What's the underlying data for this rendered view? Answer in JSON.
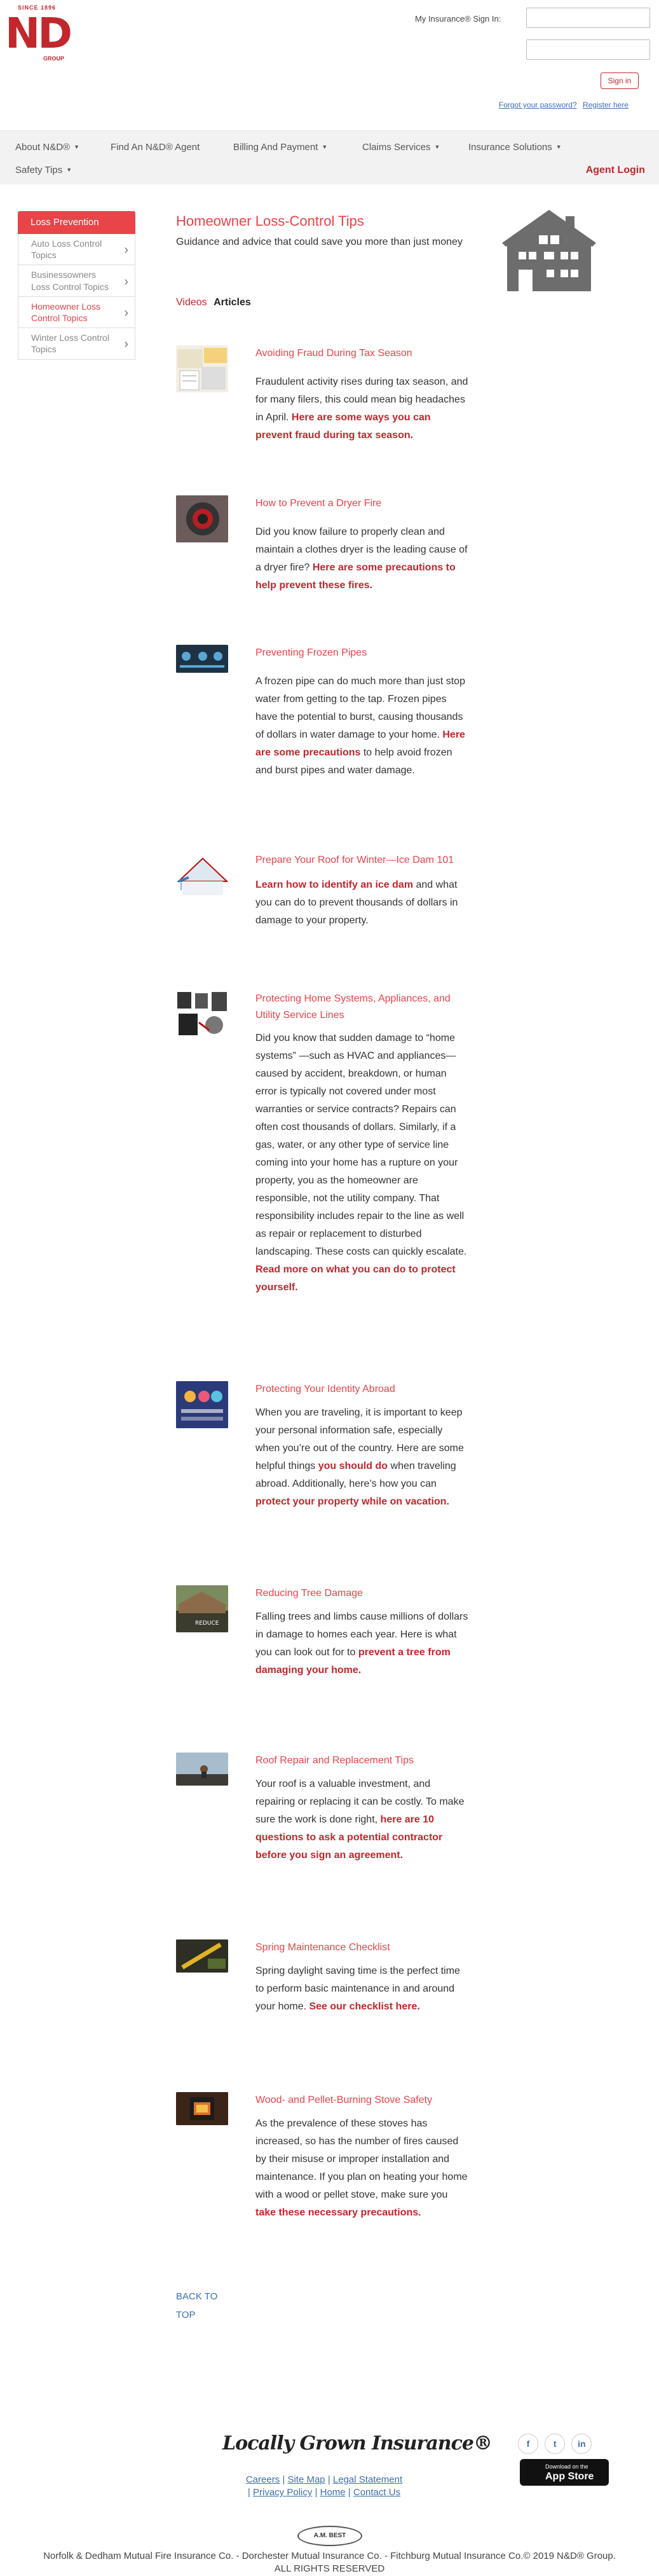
{
  "logo": {
    "tag": "SINCE 1896",
    "mark": "ND",
    "group": "GROUP"
  },
  "signin": {
    "label": "My Insurance® Sign In:",
    "button": "Sign in",
    "forgot": "Forgot your password?",
    "register": "Register here"
  },
  "nav": {
    "items": [
      "About N&D®",
      "Find An N&D® Agent",
      "Billing And Payment",
      "Claims Services",
      "Insurance Solutions",
      "Safety Tips"
    ],
    "agent_login": "Agent Login"
  },
  "sidebar": {
    "heading": "Loss Prevention",
    "items": [
      "Auto Loss Control Topics",
      "Businessowners Loss Control Topics",
      "Homeowner Loss Control Topics",
      "Winter Loss Control Topics"
    ]
  },
  "page": {
    "title": "Homeowner Loss-Control Tips",
    "subtitle": "Guidance and advice that could save you more than just money",
    "filter_videos": "Videos",
    "filter_articles": "Articles"
  },
  "articles": [
    {
      "title": "Avoiding Fraud During Tax Season",
      "text": "Fraudulent activity rises during tax season, and for many filers, this could mean big headaches in April. ",
      "link": "Here are some ways you can prevent fraud during tax season.",
      "after": ""
    },
    {
      "title": "How to Prevent a Dryer Fire",
      "text": "Did you know failure to properly clean and maintain a clothes dryer is the leading cause of a dryer fire? ",
      "link": "Here are some precautions to help prevent these fires.",
      "after": ""
    },
    {
      "title": "Preventing Frozen Pipes",
      "text": "A frozen pipe can do much more than just stop water from getting to the tap. Frozen pipes have the potential to burst, causing thousands of dollars in water damage to your home. ",
      "link": "Here are some precautions",
      "after": " to help avoid frozen and burst pipes and water damage."
    },
    {
      "title": "Prepare Your Roof for Winter—Ice Dam 101",
      "text": "",
      "link": "Learn how to identify an ice dam",
      "after": " and what you can do to prevent thousands of dollars in damage to your property."
    },
    {
      "title": "Protecting Home Systems, Appliances, and Utility Service Lines",
      "text": "Did you know that sudden damage to “home systems” —such as HVAC and appliances—caused by accident, breakdown, or human error is typically not covered under most warranties or service contracts? Repairs can often cost thousands of dollars. Similarly, if a gas, water, or any other type of service line coming into your home has a rupture on your property, you as the homeowner are responsible, not the utility company. That responsibility includes repair to the line as well as repair or replacement to disturbed landscaping. These costs can quickly escalate. ",
      "link": "Read more on what you can do to protect yourself.",
      "after": ""
    },
    {
      "title": "Protecting Your Identity Abroad",
      "text": "When you are traveling, it is important to keep your personal information safe, especially when you’re out of the country. Here are some helpful things ",
      "link": "you should do",
      "after": " when traveling abroad. Additionally, here’s how you can ",
      "link2": "protect your property while on vacation."
    },
    {
      "title": "Reducing Tree Damage",
      "text": "Falling trees and limbs cause millions of dollars in damage to homes each year. Here is what you can look out for to ",
      "link": "prevent a tree from damaging your home.",
      "after": ""
    },
    {
      "title": "Roof Repair and Replacement Tips",
      "text": "Your  roof is a valuable investment, and repairing or replacing it can be costly. To make sure the work is done right, ",
      "link": "here are 10 questions to ask a potential contractor before you sign an agreement.",
      "after": ""
    },
    {
      "title": "Spring Maintenance Checklist",
      "text": "Spring daylight saving time is the perfect time to perform basic maintenance in and around your home. ",
      "link": "See our checklist here.",
      "after": ""
    },
    {
      "title": "Wood- and Pellet-Burning Stove Safety",
      "text": "As the prevalence of these stoves has increased, so has the number of fires caused by their misuse or improper installation and maintenance. If you plan on heating your home with a wood or pellet stove, make sure you ",
      "link": "take these necessary precautions.",
      "after": ""
    }
  ],
  "back_to_top": [
    "BACK TO",
    "TOP"
  ],
  "footer": {
    "brand": "Locally Grown Insurance®",
    "links_row1": [
      "Careers",
      "Site Map",
      "Legal Statement"
    ],
    "links_row2": [
      "Privacy Policy",
      "Home",
      "Contact Us"
    ],
    "social": [
      "f",
      "t",
      "in"
    ],
    "appstore_small": "Download on the",
    "appstore_big": "App Store",
    "ambest": "A.M. BEST",
    "copyright_line1": "Norfolk & Dedham Mutual Fire Insurance Co. - Dorchester Mutual Insurance Co. - Fitchburg Mutual Insurance Co.© 2019 N&D® Group.",
    "copyright_line2": "ALL RIGHTS RESERVED"
  },
  "colors": {
    "brand_red": "#c1272d",
    "accent_red": "#e8444a",
    "link_blue": "#3f6fb0"
  }
}
